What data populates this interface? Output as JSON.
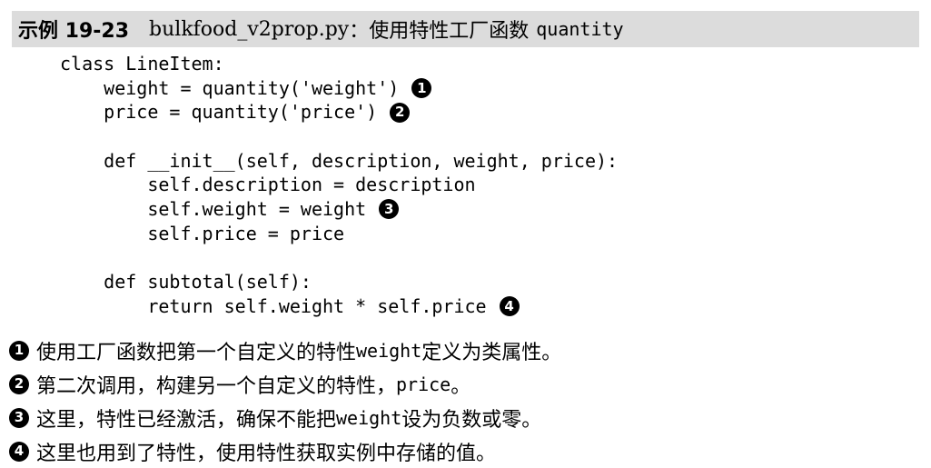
{
  "header": {
    "label": "示例 19-23",
    "filename": "bulkfood_v2prop.py",
    "separator": "：",
    "description": "使用特性工厂函数",
    "code": "quantity"
  },
  "code_lines": [
    {
      "text": "class LineItem:",
      "callout": ""
    },
    {
      "text": "    weight = quantity('weight')",
      "callout": "1"
    },
    {
      "text": "    price = quantity('price')",
      "callout": "2"
    },
    {
      "text": "",
      "callout": ""
    },
    {
      "text": "    def __init__(self, description, weight, price):",
      "callout": ""
    },
    {
      "text": "        self.description = description",
      "callout": ""
    },
    {
      "text": "        self.weight = weight",
      "callout": "3"
    },
    {
      "text": "        self.price = price",
      "callout": ""
    },
    {
      "text": "",
      "callout": ""
    },
    {
      "text": "    def subtotal(self):",
      "callout": ""
    },
    {
      "text": "        return self.weight * self.price",
      "callout": "4"
    }
  ],
  "notes": [
    {
      "num": "1",
      "before": "使用工厂函数把第一个自定义的特性 ",
      "code": "weight",
      "after": " 定义为类属性。"
    },
    {
      "num": "2",
      "before": "第二次调用，构建另一个自定义的特性，",
      "code": "price",
      "after": "。"
    },
    {
      "num": "3",
      "before": "这里，特性已经激活，确保不能把 ",
      "code": "weight",
      "after": " 设为负数或零。"
    },
    {
      "num": "4",
      "before": "这里也用到了特性，使用特性获取实例中存储的值。",
      "code": "",
      "after": ""
    }
  ]
}
